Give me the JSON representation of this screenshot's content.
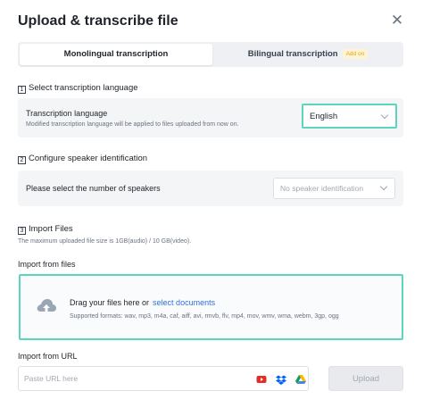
{
  "dialog": {
    "title": "Upload & transcribe file",
    "close_icon": "close-icon"
  },
  "tabs": [
    {
      "label": "Monolingual transcription",
      "active": true
    },
    {
      "label": "Bilingual transcription",
      "active": false,
      "badge": "Add on"
    }
  ],
  "section1": {
    "number": "1",
    "title": "Select transcription language",
    "label": "Transcription language",
    "hint": "Modified transcription language will be applied to files uploaded from now on.",
    "selected_language": "English"
  },
  "section2": {
    "number": "2",
    "title": "Configure speaker identification",
    "label": "Please select the number of speakers",
    "placeholder": "No speaker identification"
  },
  "section3": {
    "number": "3",
    "title": "Import Files",
    "note": "The maximum uploaded file size is 1GB(audio) / 10 GB(video).",
    "import_files_label": "Import from files",
    "drop_text": "Drag your files here or",
    "drop_link": "select documents",
    "formats": "Supported formats: wav, mp3, m4a, caf, aiff, avi, rmvb, flv, mp4, mov, wmv, wma, webm, 3gp, ogg",
    "import_url_label": "Import from URL",
    "url_placeholder": "Paste URL here",
    "upload_label": "Upload",
    "source_icons": [
      "youtube-icon",
      "dropbox-icon",
      "google-drive-icon"
    ]
  },
  "colors": {
    "highlight": "#5dd4bd",
    "link": "#2f6fde",
    "addon_text": "#e8a317"
  }
}
